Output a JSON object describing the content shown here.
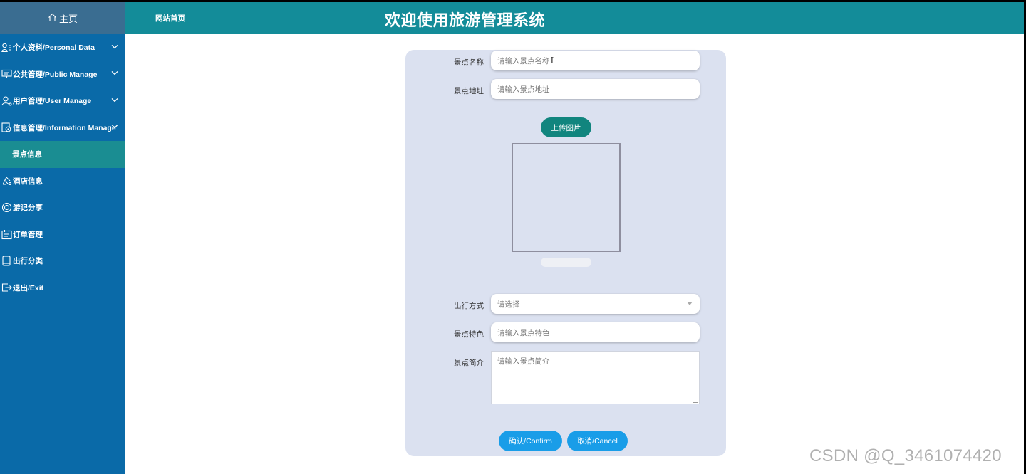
{
  "sidebar": {
    "home_label": "主页",
    "items": [
      {
        "label": "个人资料/Personal Data",
        "icon": "user-info-icon",
        "expandable": true
      },
      {
        "label": "公共管理/Public Manage",
        "icon": "monitor-icon",
        "expandable": true
      },
      {
        "label": "用户管理/User Manage",
        "icon": "user-icon",
        "expandable": true
      },
      {
        "label": "信息管理/Information Manage",
        "icon": "info-settings-icon",
        "expandable": true
      },
      {
        "label": "景点信息",
        "icon": "",
        "active": true
      },
      {
        "label": "酒店信息",
        "icon": "hotel-icon"
      },
      {
        "label": "游记分享",
        "icon": "share-icon"
      },
      {
        "label": "订单管理",
        "icon": "order-icon"
      },
      {
        "label": "出行分类",
        "icon": "category-icon"
      },
      {
        "label": "退出/Exit",
        "icon": "exit-icon"
      }
    ]
  },
  "header": {
    "home_link": "网站首页",
    "title": "欢迎使用旅游管理系统"
  },
  "form": {
    "name_label": "景点名称",
    "name_placeholder": "请输入景点名称",
    "address_label": "景点地址",
    "address_placeholder": "请输入景点地址",
    "upload_label": "上传图片",
    "travel_mode_label": "出行方式",
    "travel_mode_value": "请选择",
    "feature_label": "景点特色",
    "feature_placeholder": "请输入景点特色",
    "intro_label": "景点简介",
    "intro_placeholder": "请输入景点简介",
    "confirm_label": "确认/Confirm",
    "cancel_label": "取消/Cancel"
  },
  "watermark": "CSDN @Q_3461074420",
  "colors": {
    "sidebar_bg": "#0a6aa8",
    "header_bg": "#138c99",
    "active_item": "#1a8d92",
    "card_bg": "#dbe1f0",
    "upload_button": "#11857e",
    "action_button": "#199de8"
  }
}
